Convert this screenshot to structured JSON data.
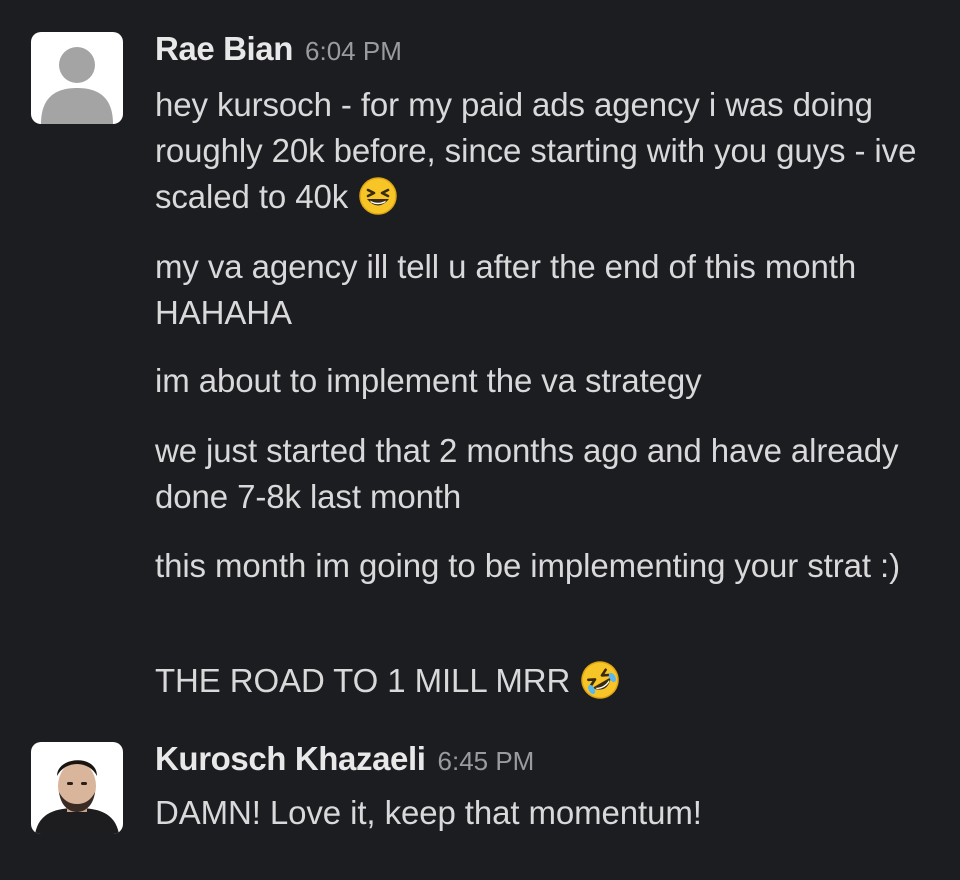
{
  "messages": [
    {
      "author": "Rae Bian",
      "timestamp": "6:04 PM",
      "avatar": "default-user-avatar",
      "lines": [
        {
          "text": "hey kursoch - for my paid ads agency i was doing roughly 20k before, since starting with you guys - ive scaled to 40k",
          "emoji": "grinning-squinting-face"
        },
        {
          "text": "my va agency ill tell u after the end of this month HAHAHA"
        },
        {
          "text": "im about to implement the va strategy"
        },
        {
          "text": "we just started that 2 months ago and have already done 7-8k last month"
        },
        {
          "text": "this month im going to be implementing your strat :)"
        },
        {
          "text": "THE ROAD TO 1 MILL MRR",
          "emoji": "rolling-on-floor-laughing"
        }
      ]
    },
    {
      "author": "Kurosch Khazaeli",
      "timestamp": "6:45 PM",
      "avatar": "profile-photo-avatar",
      "lines": [
        {
          "text": "DAMN! Love it, keep that momentum!"
        }
      ]
    }
  ]
}
